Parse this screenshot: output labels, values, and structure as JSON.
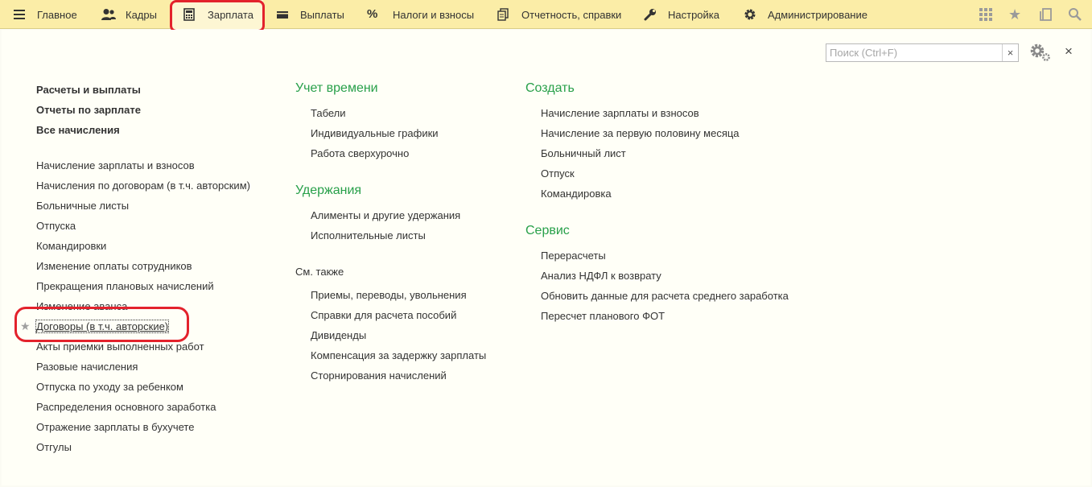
{
  "nav": {
    "sections": [
      {
        "label": "Главное",
        "icon": "hamburger-icon"
      },
      {
        "label": "Кадры",
        "icon": "people-icon"
      },
      {
        "label": "Зарплата",
        "icon": "calculator-icon"
      },
      {
        "label": "Выплаты",
        "icon": "wallet-icon"
      },
      {
        "label": "Налоги и взносы",
        "icon": "percent-icon"
      },
      {
        "label": "Отчетность, справки",
        "icon": "reports-icon"
      },
      {
        "label": "Настройка",
        "icon": "wrench-icon"
      },
      {
        "label": "Администрирование",
        "icon": "gear-icon"
      }
    ],
    "active_section": "Зарплата",
    "right_icons": [
      "apps-grid-icon",
      "favorites-star-icon",
      "history-icon",
      "global-search-icon"
    ]
  },
  "toolbar": {
    "search_placeholder": "Поиск (Ctrl+F)",
    "search_value": "",
    "clear_label": "×",
    "close_label": "×"
  },
  "col1": {
    "bold": [
      "Расчеты и выплаты",
      "Отчеты по зарплате",
      "Все начисления"
    ],
    "items": [
      "Начисление зарплаты и взносов",
      "Начисления по договорам (в т.ч. авторским)",
      "Больничные листы",
      "Отпуска",
      "Командировки",
      "Изменение оплаты сотрудников",
      "Прекращения плановых начислений",
      "Изменение аванса",
      "Договоры (в т.ч. авторские)",
      "Акты приемки выполненных работ",
      "Разовые начисления",
      "Отпуска по уходу за ребенком",
      "Распределения основного заработка",
      "Отражение зарплаты в бухучете",
      "Отгулы"
    ],
    "starred_item": "Договоры (в т.ч. авторские)",
    "star_glyph": "★"
  },
  "col2": {
    "groups": [
      {
        "header": "Учет времени",
        "items": [
          "Табели",
          "Индивидуальные графики",
          "Работа сверхурочно"
        ]
      },
      {
        "header": "Удержания",
        "items": [
          "Алименты и другие удержания",
          "Исполнительные листы"
        ]
      }
    ],
    "see_also_label": "См. также",
    "see_also_items": [
      "Приемы, переводы, увольнения",
      "Справки для расчета пособий",
      "Дивиденды",
      "Компенсация за задержку зарплаты",
      "Сторнирования начислений"
    ]
  },
  "col3": {
    "groups": [
      {
        "header": "Создать",
        "items": [
          "Начисление зарплаты и взносов",
          "Начисление за первую половину месяца",
          "Больничный лист",
          "Отпуск",
          "Командировка"
        ]
      },
      {
        "header": "Сервис",
        "items": [
          "Перерасчеты",
          "Анализ НДФЛ к возврату",
          "Обновить данные для расчета среднего заработка",
          "Пересчет планового ФОТ"
        ]
      }
    ]
  },
  "colors": {
    "accent_green": "#28a04a",
    "topbar_bg": "#fbeda7",
    "highlight_red": "#e3222c"
  }
}
